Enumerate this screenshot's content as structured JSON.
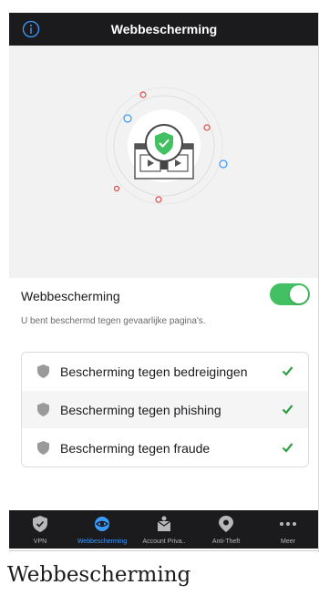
{
  "header": {
    "title": "Webbescherming",
    "info_icon": "info-icon"
  },
  "hero": {
    "illustration": "web-shield-illustration",
    "accent_color": "#43c062"
  },
  "toggle": {
    "label": "Webbescherming",
    "enabled": true,
    "description": "U bent beschermd tegen gevaarlijke pagina's.",
    "color": "#43c062"
  },
  "protections": [
    {
      "label": "Bescherming tegen bedreigingen",
      "icon": "shield-icon",
      "status": "check-icon"
    },
    {
      "label": "Bescherming tegen phishing",
      "icon": "shield-icon",
      "status": "check-icon"
    },
    {
      "label": "Bescherming tegen fraude",
      "icon": "shield-icon",
      "status": "check-icon"
    }
  ],
  "tabbar": {
    "active_color": "#3a9bff",
    "tabs": [
      {
        "label": "VPN",
        "icon": "vpn-shield-icon",
        "active": false
      },
      {
        "label": "Webbescherming",
        "icon": "web-protection-icon",
        "active": true
      },
      {
        "label": "Account Priva..",
        "icon": "account-privacy-icon",
        "active": false
      },
      {
        "label": "Anti-Theft",
        "icon": "location-pin-icon",
        "active": false
      },
      {
        "label": "Meer",
        "icon": "more-icon",
        "active": false
      }
    ]
  },
  "caption": "Webbescherming"
}
